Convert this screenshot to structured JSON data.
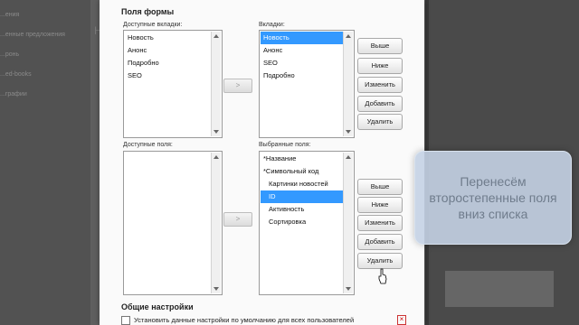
{
  "background": {
    "sidebar_items": [
      "...ения",
      "...енные предложения",
      "...ронь",
      "...ed-books",
      "...графии"
    ],
    "heading": "Но"
  },
  "dialog": {
    "form_fields_title": "Поля формы",
    "available_tabs": {
      "label": "Доступные вкладки:",
      "items": [
        "Новость",
        "Анонс",
        "Подробно",
        "SEO"
      ]
    },
    "tabs": {
      "label": "Вкладки:",
      "items": [
        "Новость",
        "Анонс",
        "SEO",
        "Подробно"
      ],
      "selected_index": 0
    },
    "available_fields": {
      "label": "Доступные поля:",
      "items": []
    },
    "selected_fields": {
      "label": "Выбранные поля:",
      "items": [
        "*Название",
        "*Символьный код",
        "Картинки новостей",
        "ID",
        "Активность",
        "Сортировка"
      ],
      "selected_index": 3
    },
    "move_right_label": ">",
    "buttons": {
      "up": "Выше",
      "down": "Ниже",
      "edit": "Изменить",
      "add": "Добавить",
      "delete": "Удалить"
    },
    "general_settings_title": "Общие настройки",
    "default_checkbox_label": "Установить данные настройки по умолчанию для всех пользователей"
  },
  "tooltip": {
    "lines": [
      "Перенесём",
      "второстепенные поля",
      "вниз списка"
    ]
  }
}
